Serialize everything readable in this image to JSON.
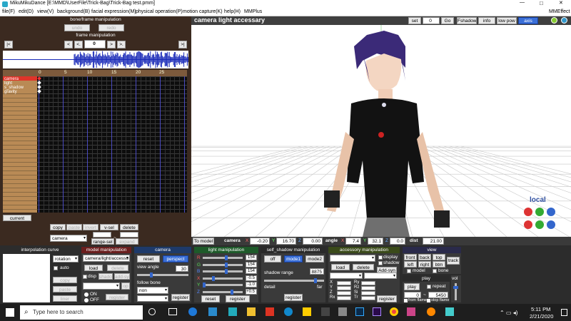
{
  "window": {
    "title": "MikuMikuDance [E:\\MMD\\UserFile\\Trick-Bag\\Trick-Bag test.pmm]",
    "min": "—",
    "max": "□",
    "close": "✕"
  },
  "menu": {
    "items": [
      "file(F)",
      "edit(D)",
      "view(V)",
      "background(B)",
      "facial expression(M)",
      "physical operation(P)",
      "motion capture(K)",
      "help(H)",
      "MMPlus"
    ],
    "right": "MMEffect"
  },
  "bone": {
    "title": "bone/frame manipulation",
    "undo": "undo",
    "redo": "redo",
    "frame_title": "frame manipulation",
    "frame": "0",
    "first": "|<",
    "prev": "<",
    "minus": "<.",
    "next": ">",
    "next2": ">.",
    "last": ">|"
  },
  "tracks": {
    "ticks": [
      "0",
      "5",
      "10",
      "15",
      "20",
      "25"
    ],
    "rows": [
      "camera",
      "light",
      "s_shadow",
      "gravity"
    ],
    "current": "current"
  },
  "tl_buttons": {
    "copy": "copy",
    "paste": "paste",
    "invert": "invert",
    "vsel": "v-sel",
    "delete": "delete",
    "camera_sel": "camera",
    "range_sel": "range-sel",
    "expand": "expand",
    "dash": "~"
  },
  "viewport": {
    "title": "camera light accessary",
    "set": "set",
    "set_val": "0",
    "go": "Go",
    "fshadow": "Fshadow",
    "info": "info",
    "lowpow": "low pow",
    "axis": "axis",
    "local": "local"
  },
  "statusbar": {
    "to_model": "To model",
    "camera": "camera",
    "cx": "-0.20",
    "cy": "16.70",
    "cz": "0.00",
    "angle": "angle",
    "ax": "7.4",
    "ay": "32.1",
    "az": "0.0",
    "dist": "dist",
    "dist_val": "21.00",
    "X": "X",
    "Y": "Y",
    "Z": "Z"
  },
  "interp": {
    "title": "interpolation curve",
    "rotation": "rotation",
    "auto": "auto",
    "copy": "copy",
    "paste": "paste",
    "liner": "liner"
  },
  "modelmanip": {
    "title": "model manipulation",
    "model": "camera/light/accesso",
    "load": "load",
    "delete": "delete",
    "disp": "disp",
    "shadow": "shadow",
    "addsyn": "add-syn",
    "on": "ON",
    "off": "OFF",
    "register": "register",
    "op": "op"
  },
  "camera": {
    "title": "camera",
    "reset": "reset",
    "perspect": "perspect",
    "view_angle": "view angle",
    "angle_val": "30",
    "follow_bone": "follow bone",
    "non": "non",
    "register": "register"
  },
  "light": {
    "title": "light manipulation",
    "labels": [
      "R",
      "G",
      "B",
      "X",
      "Y",
      "Z"
    ],
    "vals": [
      "154",
      "154",
      "154",
      "-0.5",
      "-1.0",
      "+0.5"
    ],
    "fracs": [
      0.6,
      0.6,
      0.6,
      0.25,
      0.0,
      0.75
    ],
    "reset": "reset",
    "register": "register"
  },
  "shadow": {
    "title": "self_shadow manipulation",
    "off": "off",
    "mode1": "mode1",
    "mode2": "mode2",
    "range": "shadow range",
    "range_val": "8875",
    "detail": "detail",
    "far": "far",
    "register": "register"
  },
  "accessory": {
    "title": "accessory manipulation",
    "disp": "display",
    "shadow": "shadow",
    "addsyn": "Add-syn",
    "load": "load",
    "delete": "delete",
    "labels": [
      "X",
      "Y",
      "Z",
      "Rx",
      "Ry",
      "Rz",
      "Si",
      "Tr"
    ],
    "register": "register"
  },
  "view": {
    "title": "view",
    "front": "front",
    "back": "back",
    "top": "top",
    "track": "track",
    "left": "left",
    "right": "right",
    "btm": "btm",
    "model": "model",
    "bone": "bone"
  },
  "play": {
    "title": "play",
    "play": "play",
    "repeat": "repeat",
    "vol": "vol",
    "from_val": "0",
    "to_val": "5450",
    "from": "from flame",
    "stop": "stop flame",
    "dash": "~"
  },
  "taskbar": {
    "search": "Type here to search",
    "time": "5:11 PM",
    "date": "2/21/2020"
  }
}
